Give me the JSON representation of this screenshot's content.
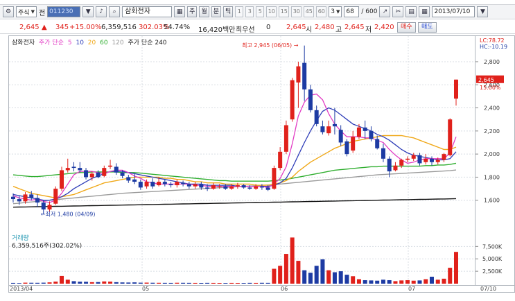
{
  "toolbar": {
    "market_label": "주식",
    "market_suffix": "전",
    "code_value": "011230",
    "stock_name": "삼화전자",
    "period_buttons": [
      "주",
      "월",
      "분",
      "틱"
    ],
    "minute_options": [
      "1",
      "3",
      "5",
      "10",
      "15",
      "30",
      "45",
      "60"
    ],
    "minute_selected": "3",
    "count_value": "68",
    "count_max": "/ 600",
    "date_value": "2013/07/10"
  },
  "quote": {
    "price": "2,645",
    "change": "345",
    "change_pct": "+15.00%",
    "volume": "6,359,516",
    "volume_ratio": "302.03%",
    "turnover": "54.74%",
    "amount": "16,420백만",
    "pref_label": "최우선",
    "pref_value": "0",
    "last": "2,645",
    "low_label": "시",
    "open": "2,480",
    "high_label": "고",
    "high": "2,645",
    "low2_label": "저",
    "low": "2,420",
    "buy_label": "매수",
    "sell_label": "매도"
  },
  "colors": {
    "up": "#e0211b",
    "down": "#1d3ba3",
    "ma5": "#e23cc4",
    "ma10": "#2e3db8",
    "ma20": "#f0a818",
    "ma60": "#2fae2f",
    "ma120": "#9a9a9a",
    "ma240": "#111111"
  },
  "chart_data": {
    "type": "candlestick",
    "title": "삼화전자",
    "legend_price": "주가 단순",
    "ma_periods": [
      5,
      10,
      20,
      60,
      120
    ],
    "legend_ma240": "주가 단순 240",
    "ylim": [
      1400,
      2950
    ],
    "yticks": [
      "2,800",
      "2,600",
      "2,400",
      "2,200",
      "2,000",
      "1,800",
      "1,600"
    ],
    "y_right_top": "LC:78.72",
    "y_right_top2": "HC:-10.19",
    "current_label": "2,645",
    "current_pct": "15.00%",
    "max_label": "최고 2,945 (06/05)",
    "min_label": "최저 1,480 (04/09)",
    "x_labels": [
      "2013/04",
      "05",
      "06",
      "07",
      "07/10"
    ],
    "candles": [
      [
        1630,
        1610,
        1660,
        1580
      ],
      [
        1610,
        1590,
        1640,
        1560
      ],
      [
        1590,
        1650,
        1670,
        1570
      ],
      [
        1650,
        1620,
        1680,
        1600
      ],
      [
        1620,
        1580,
        1650,
        1540
      ],
      [
        1580,
        1520,
        1600,
        1480
      ],
      [
        1520,
        1560,
        1590,
        1500
      ],
      [
        1570,
        1700,
        1720,
        1560
      ],
      [
        1700,
        1860,
        1890,
        1680
      ],
      [
        1860,
        1880,
        1960,
        1840
      ],
      [
        1890,
        1880,
        1930,
        1850
      ],
      [
        1880,
        1860,
        1930,
        1840
      ],
      [
        1860,
        1800,
        1880,
        1780
      ],
      [
        1800,
        1830,
        1850,
        1770
      ],
      [
        1840,
        1800,
        1860,
        1790
      ],
      [
        1810,
        1880,
        1900,
        1800
      ],
      [
        1890,
        1900,
        1950,
        1870
      ],
      [
        1890,
        1840,
        1920,
        1820
      ],
      [
        1840,
        1810,
        1860,
        1790
      ],
      [
        1800,
        1770,
        1820,
        1750
      ],
      [
        1780,
        1760,
        1830,
        1740
      ],
      [
        1760,
        1710,
        1780,
        1690
      ],
      [
        1720,
        1760,
        1780,
        1700
      ],
      [
        1760,
        1720,
        1790,
        1700
      ],
      [
        1730,
        1760,
        1800,
        1720
      ],
      [
        1760,
        1740,
        1780,
        1720
      ],
      [
        1740,
        1730,
        1760,
        1710
      ],
      [
        1730,
        1760,
        1780,
        1710
      ],
      [
        1750,
        1740,
        1770,
        1720
      ],
      [
        1740,
        1720,
        1760,
        1700
      ],
      [
        1720,
        1740,
        1760,
        1700
      ],
      [
        1740,
        1710,
        1760,
        1690
      ],
      [
        1710,
        1700,
        1740,
        1680
      ],
      [
        1700,
        1730,
        1750,
        1690
      ],
      [
        1720,
        1720,
        1740,
        1700
      ],
      [
        1720,
        1700,
        1740,
        1690
      ],
      [
        1700,
        1720,
        1740,
        1690
      ],
      [
        1720,
        1730,
        1750,
        1700
      ],
      [
        1730,
        1710,
        1740,
        1700
      ],
      [
        1710,
        1700,
        1730,
        1690
      ],
      [
        1700,
        1720,
        1740,
        1690
      ],
      [
        1720,
        1710,
        1740,
        1690
      ],
      [
        1710,
        1690,
        1730,
        1680
      ],
      [
        1700,
        1880,
        1900,
        1690
      ],
      [
        1880,
        2020,
        2060,
        1860
      ],
      [
        2020,
        2250,
        2290,
        2000
      ],
      [
        2300,
        2640,
        2660,
        2280
      ],
      [
        2620,
        2760,
        2800,
        2400
      ],
      [
        2790,
        2560,
        2940,
        2460
      ],
      [
        2560,
        2380,
        2600,
        2360
      ],
      [
        2380,
        2260,
        2420,
        2240
      ],
      [
        2240,
        2190,
        2290,
        2170
      ],
      [
        2180,
        2240,
        2290,
        2160
      ],
      [
        2260,
        2240,
        2400,
        2170
      ],
      [
        2210,
        2100,
        2250,
        2070
      ],
      [
        2110,
        2000,
        2130,
        1980
      ],
      [
        2030,
        2150,
        2200,
        2010
      ],
      [
        2150,
        2230,
        2260,
        2130
      ],
      [
        2230,
        2200,
        2290,
        2130
      ],
      [
        2200,
        2130,
        2240,
        2110
      ],
      [
        2130,
        2050,
        2160,
        2040
      ],
      [
        2050,
        1960,
        2090,
        1930
      ],
      [
        1960,
        1850,
        1980,
        1800
      ],
      [
        1860,
        1900,
        1930,
        1850
      ],
      [
        1900,
        1950,
        1960,
        1880
      ],
      [
        1950,
        1960,
        1980,
        1930
      ],
      [
        1960,
        1990,
        2010,
        1940
      ],
      [
        1990,
        1920,
        2010,
        1900
      ],
      [
        1930,
        1960,
        2000,
        1910
      ],
      [
        1960,
        1930,
        1980,
        1900
      ],
      [
        1930,
        1950,
        1970,
        1910
      ],
      [
        1950,
        2000,
        2010,
        1930
      ],
      [
        1990,
        2300,
        2310,
        1980
      ],
      [
        2480,
        2645,
        2645,
        2420
      ]
    ],
    "ma5": [
      1640,
      1620,
      1610,
      1600,
      1610,
      1590,
      1580,
      1600,
      1660,
      1740,
      1820,
      1850,
      1850,
      1850,
      1840,
      1830,
      1850,
      1860,
      1860,
      1840,
      1810,
      1790,
      1760,
      1750,
      1740,
      1740,
      1740,
      1740,
      1740,
      1740,
      1730,
      1730,
      1720,
      1720,
      1720,
      1720,
      1720,
      1720,
      1720,
      1720,
      1720,
      1720,
      1710,
      1740,
      1790,
      1890,
      2090,
      2330,
      2450,
      2510,
      2520,
      2470,
      2350,
      2260,
      2200,
      2150,
      2150,
      2150,
      2140,
      2140,
      2120,
      2100,
      2040,
      1990,
      1950,
      1920,
      1930,
      1950,
      1960,
      1960,
      1960,
      1960,
      2010,
      2150
    ],
    "ma10": [
      1650,
      1640,
      1630,
      1620,
      1610,
      1600,
      1600,
      1610,
      1630,
      1660,
      1700,
      1730,
      1760,
      1790,
      1810,
      1830,
      1850,
      1850,
      1850,
      1840,
      1830,
      1820,
      1810,
      1800,
      1790,
      1780,
      1770,
      1760,
      1750,
      1740,
      1740,
      1740,
      1730,
      1730,
      1730,
      1730,
      1730,
      1720,
      1720,
      1720,
      1720,
      1720,
      1720,
      1730,
      1750,
      1790,
      1880,
      1990,
      2100,
      2200,
      2290,
      2370,
      2400,
      2380,
      2340,
      2300,
      2260,
      2240,
      2220,
      2200,
      2170,
      2150,
      2120,
      2080,
      2040,
      2010,
      1990,
      1980,
      1970,
      1960,
      1950,
      1950,
      1960,
      2020
    ],
    "ma20": [
      1720,
      1700,
      1680,
      1660,
      1650,
      1640,
      1630,
      1620,
      1630,
      1640,
      1650,
      1670,
      1690,
      1710,
      1730,
      1750,
      1760,
      1770,
      1780,
      1790,
      1800,
      1800,
      1800,
      1800,
      1800,
      1790,
      1790,
      1780,
      1780,
      1770,
      1760,
      1760,
      1750,
      1750,
      1750,
      1740,
      1740,
      1740,
      1740,
      1740,
      1730,
      1730,
      1730,
      1740,
      1750,
      1770,
      1800,
      1850,
      1890,
      1930,
      1960,
      1990,
      2020,
      2050,
      2070,
      2090,
      2110,
      2120,
      2130,
      2140,
      2150,
      2160,
      2160,
      2160,
      2160,
      2150,
      2140,
      2120,
      2100,
      2080,
      2060,
      2040,
      2040,
      2060
    ],
    "ma60": [
      1820,
      1815,
      1810,
      1805,
      1805,
      1810,
      1815,
      1820,
      1825,
      1830,
      1835,
      1840,
      1840,
      1845,
      1845,
      1845,
      1845,
      1845,
      1840,
      1840,
      1840,
      1835,
      1830,
      1825,
      1820,
      1815,
      1810,
      1805,
      1800,
      1795,
      1790,
      1785,
      1780,
      1775,
      1770,
      1770,
      1765,
      1765,
      1765,
      1765,
      1765,
      1765,
      1765,
      1770,
      1775,
      1780,
      1790,
      1800,
      1810,
      1820,
      1830,
      1840,
      1850,
      1860,
      1865,
      1870,
      1875,
      1880,
      1885,
      1890,
      1890,
      1895,
      1895,
      1895,
      1895,
      1895,
      1895,
      1895,
      1900,
      1900,
      1905,
      1905,
      1910,
      1920
    ],
    "ma120": [
      1570,
      1575,
      1580,
      1585,
      1590,
      1595,
      1600,
      1605,
      1610,
      1615,
      1620,
      1625,
      1630,
      1635,
      1640,
      1645,
      1650,
      1655,
      1660,
      1663,
      1666,
      1669,
      1672,
      1675,
      1678,
      1681,
      1684,
      1687,
      1690,
      1693,
      1696,
      1699,
      1702,
      1705,
      1708,
      1711,
      1714,
      1717,
      1720,
      1723,
      1726,
      1729,
      1732,
      1735,
      1740,
      1745,
      1750,
      1755,
      1760,
      1765,
      1770,
      1775,
      1780,
      1785,
      1790,
      1795,
      1800,
      1805,
      1810,
      1815,
      1820,
      1823,
      1826,
      1829,
      1832,
      1835,
      1838,
      1841,
      1844,
      1847,
      1850,
      1853,
      1856,
      1862
    ],
    "ma240": [
      1540,
      1541,
      1542,
      1543,
      1544,
      1545,
      1546,
      1547,
      1548,
      1549,
      1550,
      1551,
      1552,
      1553,
      1554,
      1555,
      1556,
      1557,
      1558,
      1559,
      1560,
      1561,
      1562,
      1563,
      1564,
      1565,
      1566,
      1567,
      1568,
      1569,
      1570,
      1571,
      1572,
      1573,
      1574,
      1575,
      1576,
      1577,
      1578,
      1579,
      1580,
      1581,
      1582,
      1583,
      1584,
      1585,
      1586,
      1587,
      1588,
      1589,
      1590,
      1591,
      1592,
      1593,
      1594,
      1595,
      1596,
      1597,
      1598,
      1599,
      1600,
      1601,
      1602,
      1603,
      1604,
      1605,
      1606,
      1607,
      1608,
      1609,
      1610,
      1611,
      1612,
      1614
    ],
    "volume_title": "거래량",
    "volume_summary": "6,359,516주(302.02%)",
    "volume_yticks": [
      "7,500K",
      "5,000K",
      "2,500K"
    ],
    "volume_ylim": [
      0,
      9500
    ],
    "volumes": [
      150,
      120,
      200,
      180,
      170,
      200,
      260,
      420,
      1550,
      800,
      500,
      400,
      380,
      300,
      320,
      450,
      420,
      300,
      250,
      230,
      260,
      200,
      210,
      180,
      170,
      160,
      150,
      180,
      170,
      160,
      150,
      140,
      160,
      150,
      140,
      130,
      150,
      140,
      130,
      160,
      150,
      170,
      160,
      3000,
      3600,
      6000,
      9300,
      4600,
      2700,
      2200,
      3600,
      4900,
      2700,
      2300,
      2500,
      1800,
      1500,
      900,
      700,
      650,
      600,
      800,
      700,
      500,
      650,
      700,
      600,
      650,
      900,
      1400,
      800,
      1000,
      3200,
      6400
    ]
  }
}
